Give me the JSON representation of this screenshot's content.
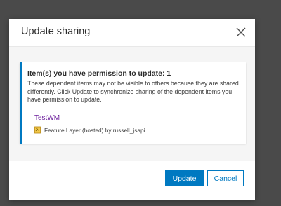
{
  "dialog": {
    "title": "Update sharing",
    "close_icon": "close-icon"
  },
  "notice": {
    "title": "Item(s) you have permission to update: 1",
    "text": "These dependent items may not be visible to others because they are shared differently. Click Update to synchronize sharing of the dependent items you have permission to update.",
    "item": {
      "name": "TestWM",
      "icon": "feature-layer-icon",
      "meta": "Feature Layer (hosted) by russell_jsapi"
    }
  },
  "footer": {
    "update_label": "Update",
    "cancel_label": "Cancel"
  },
  "colors": {
    "accent": "#0079c1",
    "link": "#6a1b9a",
    "overlay": "#4a4a4a"
  }
}
